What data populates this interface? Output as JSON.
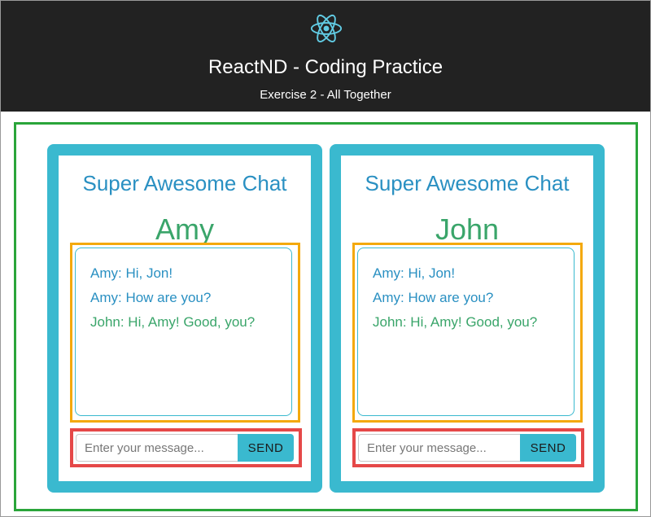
{
  "header": {
    "logo_icon": "react-atom-icon",
    "title": "ReactND - Coding Practice",
    "subtitle": "Exercise 2 - All Together"
  },
  "colors": {
    "header_bg": "#222222",
    "container_border": "#2aa53a",
    "window_border": "#3ab9cf",
    "message_box_border": "#f4a90d",
    "input_box_border": "#e54848",
    "title_blue": "#2a90c2",
    "name_green": "#3aa56a"
  },
  "chats": [
    {
      "title": "Super Awesome Chat",
      "user": "Amy",
      "messages": [
        {
          "user": "Amy",
          "text": "Amy: Hi, Jon!"
        },
        {
          "user": "Amy",
          "text": "Amy: How are you?"
        },
        {
          "user": "John",
          "text": "John: Hi, Amy! Good, you?"
        }
      ],
      "input_placeholder": "Enter your message...",
      "input_value": "",
      "send_label": "SEND"
    },
    {
      "title": "Super Awesome Chat",
      "user": "John",
      "messages": [
        {
          "user": "Amy",
          "text": "Amy: Hi, Jon!"
        },
        {
          "user": "Amy",
          "text": "Amy: How are you?"
        },
        {
          "user": "John",
          "text": "John: Hi, Amy! Good, you?"
        }
      ],
      "input_placeholder": "Enter your message...",
      "input_value": "",
      "send_label": "SEND"
    }
  ]
}
